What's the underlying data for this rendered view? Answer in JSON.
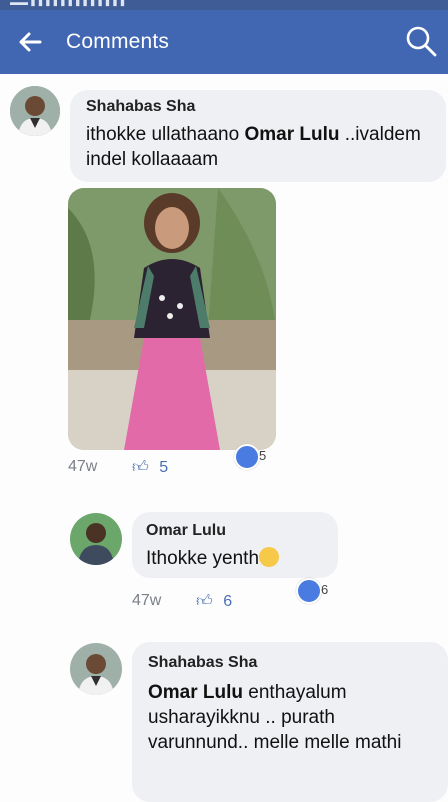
{
  "header": {
    "title": "Comments"
  },
  "comments": [
    {
      "author": "Shahabas Sha",
      "text_before": "ithokke ullathaano ",
      "mention": "Omar Lulu",
      "text_after": " ..ivaldem indel kollaaaam",
      "time": "47w",
      "likes": "5",
      "reactions": "5"
    },
    {
      "author": "Omar Lulu",
      "text": "Ithokke yenth",
      "time": "47w",
      "likes": "6",
      "reactions": "6"
    },
    {
      "author": "Shahabas Sha",
      "mention": "Omar Lulu",
      "text_after": " enthayalum usharayikknu .. purath varunnund.. melle melle mathi"
    }
  ],
  "colors": {
    "header_bg": "#4267b2",
    "bubble_bg": "#eef0f4",
    "like_blue": "#4b6fb3"
  },
  "icons": {
    "back": "arrow-left-icon",
    "search": "search-icon",
    "like": "thumbs-up-icon",
    "smiley": "smirk-emoji-icon"
  }
}
